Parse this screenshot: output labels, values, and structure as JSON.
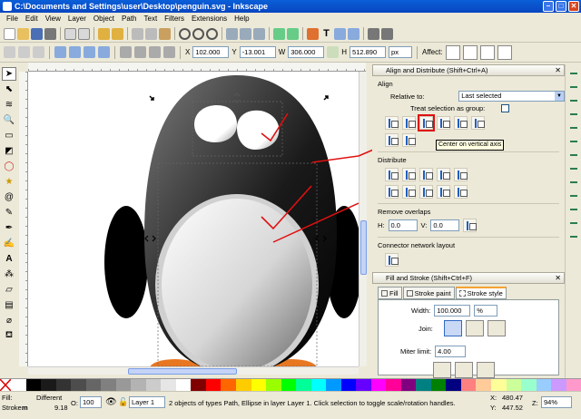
{
  "window": {
    "title": "C:\\Documents and Settings\\user\\Desktop\\penguin.svg - Inkscape"
  },
  "menu": [
    "File",
    "Edit",
    "View",
    "Layer",
    "Object",
    "Path",
    "Text",
    "Filters",
    "Extensions",
    "Help"
  ],
  "toolbar2": {
    "x_label": "X",
    "x_value": "102.000",
    "y_label": "Y",
    "y_value": "-13.001",
    "w_label": "W",
    "w_value": "306.000",
    "h_label": "H",
    "h_value": "512.890",
    "unit": "px",
    "affect_label": "Affect:"
  },
  "align_panel": {
    "title": "Align and Distribute (Shift+Ctrl+A)",
    "align_section": "Align",
    "relative_label": "Relative to:",
    "relative_value": "Last selected",
    "treat_label": "Treat selection as group:",
    "tooltip": "Center on vertical axis",
    "distribute_section": "Distribute",
    "overlap_section": "Remove overlaps",
    "h_label": "H:",
    "h_value": "0.0",
    "v_label": "V:",
    "v_value": "0.0",
    "connector_section": "Connector network layout"
  },
  "fill_panel": {
    "title": "Fill and Stroke (Shift+Ctrl+F)",
    "tab_fill": "Fill",
    "tab_stroke_paint": "Stroke paint",
    "tab_stroke_style": "Stroke style",
    "width_label": "Width:",
    "width_value": "100.000",
    "width_unit": "%",
    "join_label": "Join:",
    "miter_label": "Miter limit:",
    "miter_value": "4.00"
  },
  "palette": [
    "#ffffff",
    "#000000",
    "#1a1a1a",
    "#333333",
    "#4d4d4d",
    "#666666",
    "#808080",
    "#999999",
    "#b3b3b3",
    "#cccccc",
    "#e6e6e6",
    "#ffffff",
    "#800000",
    "#ff0000",
    "#ff6600",
    "#ffcc00",
    "#ffff00",
    "#99ff00",
    "#00ff00",
    "#00ff99",
    "#00ffff",
    "#0099ff",
    "#0000ff",
    "#6600ff",
    "#ff00ff",
    "#ff0099",
    "#800080",
    "#008080",
    "#008000",
    "#000080",
    "#ff8080",
    "#ffcc99",
    "#ffff99",
    "#ccff99",
    "#99ffcc",
    "#99ccff",
    "#cc99ff",
    "#ff99cc"
  ],
  "status": {
    "fill_label": "Fill:",
    "fill_value": "Different",
    "stroke_label": "Stroke:",
    "stroke_mode": "m",
    "stroke_width": "9.18",
    "opacity_label": "O:",
    "opacity_value": "100",
    "layer": "Layer 1",
    "message": "2 objects of types Path, Ellipse in layer Layer 1. Click selection to toggle scale/rotation handles.",
    "x_label": "X:",
    "x_value": "480.47",
    "y_label": "Y:",
    "y_value": "447.52",
    "z_label": "Z:",
    "zoom": "94%"
  }
}
